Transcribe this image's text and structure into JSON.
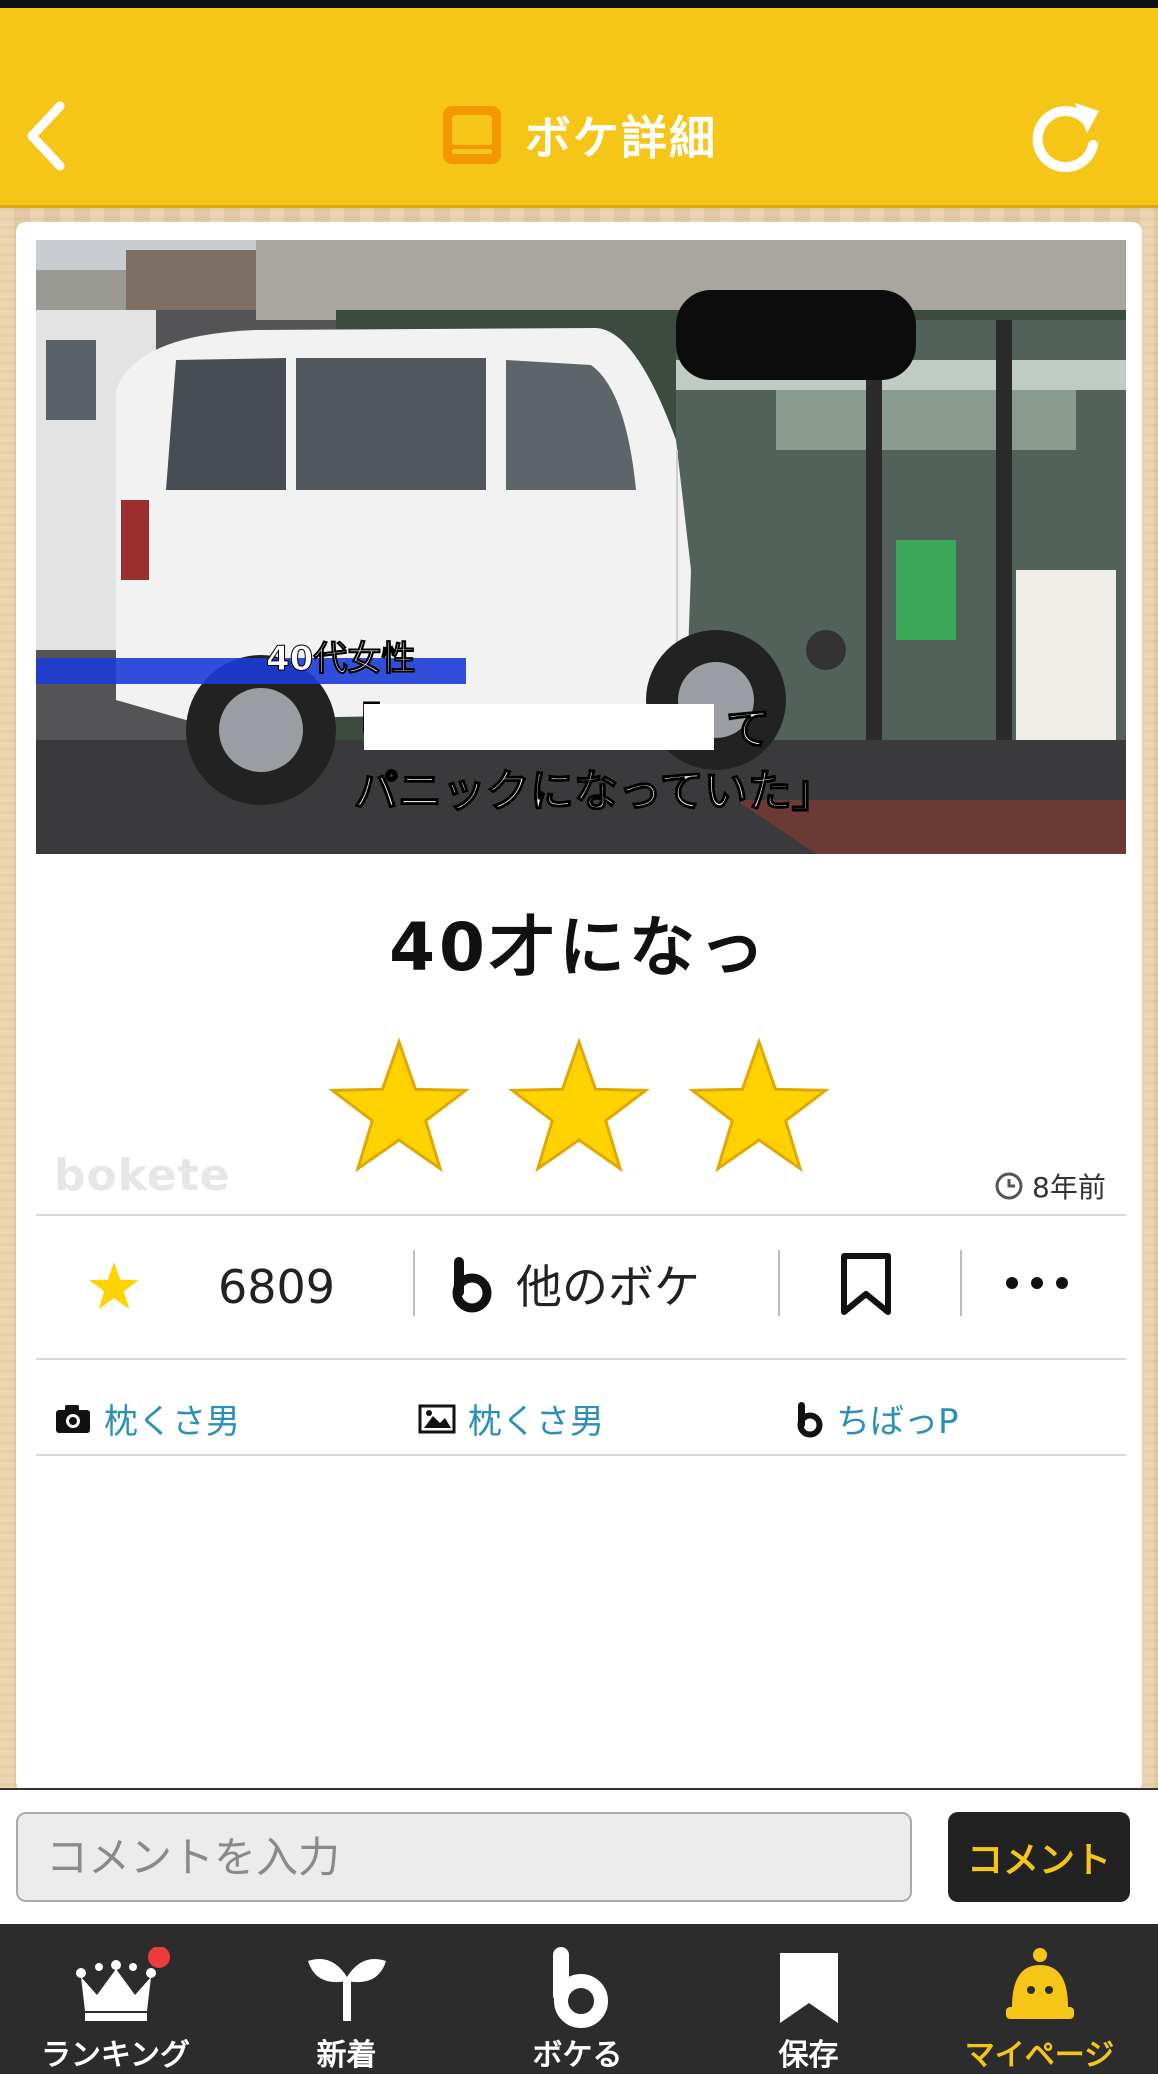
{
  "header": {
    "title": "ボケ詳細"
  },
  "photo": {
    "caption_label": "40代女性",
    "caption_open": "「",
    "caption_tail": "て",
    "caption_line2": "パニックになっていた」"
  },
  "boke": {
    "text": "40才になっ",
    "star_rating": 3,
    "watermark": "bokete",
    "posted_ago": "8年前"
  },
  "actions": {
    "star_count": "6809",
    "other_boke_label": "他のボケ"
  },
  "credits": {
    "photographer": "枕くさ男",
    "image_poster": "枕くさ男",
    "boke_author": "ちばっP"
  },
  "comment": {
    "placeholder": "コメントを入力",
    "submit_label": "コメント"
  },
  "tabbar": {
    "tabs": [
      {
        "label": "ランキング",
        "icon": "crown-icon",
        "badge": true
      },
      {
        "label": "新着",
        "icon": "sprout-icon"
      },
      {
        "label": "ボケる",
        "icon": "bokete-b-icon"
      },
      {
        "label": "保存",
        "icon": "bookmark-icon"
      },
      {
        "label": "マイページ",
        "icon": "bell-person-icon",
        "active": true
      }
    ]
  },
  "colors": {
    "accent": "#f5c518",
    "link": "#2a8fba",
    "star": "#ffd200",
    "tabbar": "#2c2c2c"
  }
}
